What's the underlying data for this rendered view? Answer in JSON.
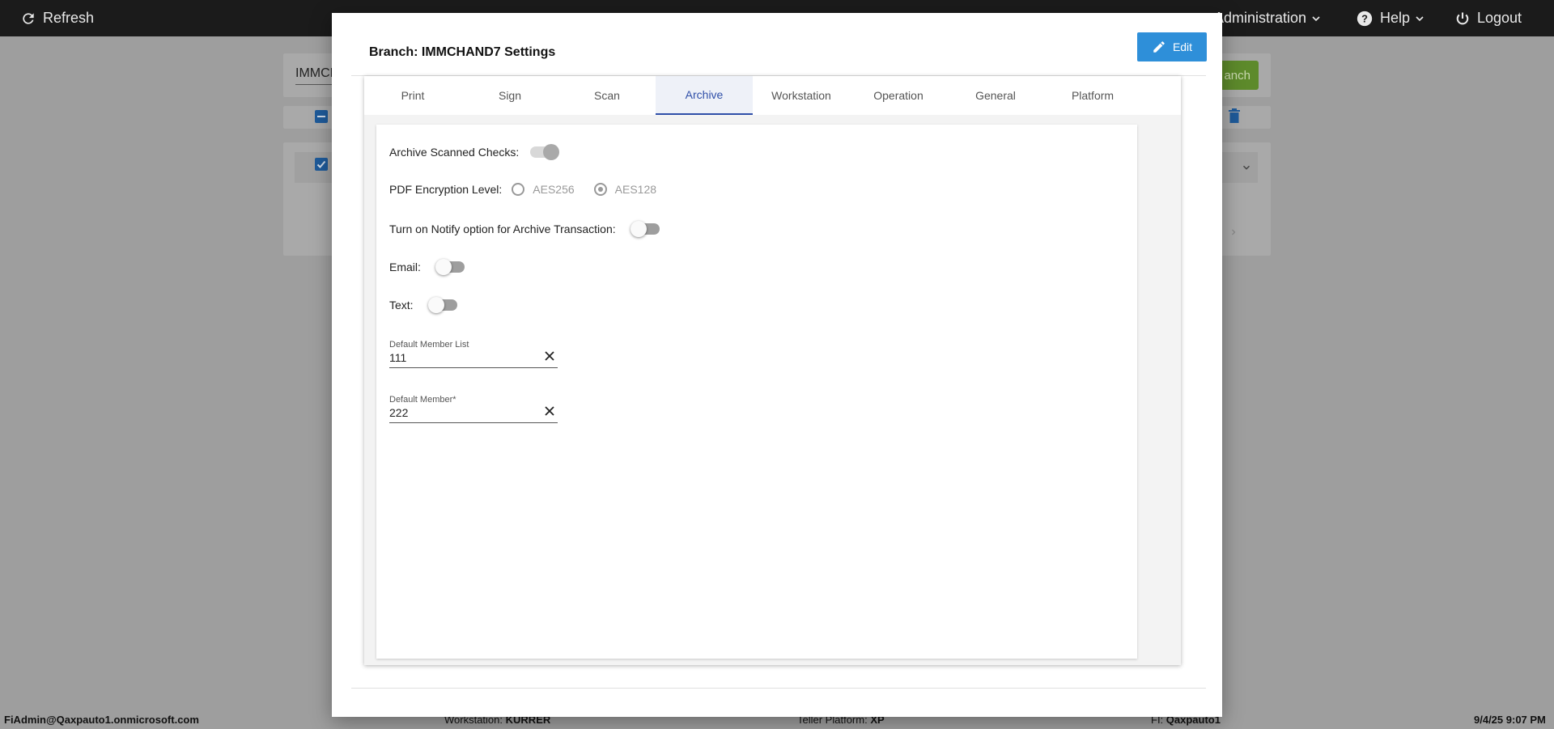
{
  "topbar": {
    "refresh_label": "Refresh",
    "administration_label": "Administration",
    "help_label": "Help",
    "logout_label": "Logout"
  },
  "background": {
    "search_text": "IMMCH",
    "green_button_partial": "anch"
  },
  "footer": {
    "user": "FiAdmin@Qaxpauto1.onmicrosoft.com",
    "workstation_label": "Workstation:",
    "workstation_value": "KURRER",
    "platform_label": "Teller Platform:",
    "platform_value": "XP",
    "fi_label": "FI:",
    "fi_value": "Qaxpauto1",
    "datetime": "9/4/25 9:07 PM"
  },
  "modal": {
    "title": "Branch: IMMCHAND7 Settings",
    "edit_label": "Edit",
    "tabs": [
      {
        "label": "Print"
      },
      {
        "label": "Sign"
      },
      {
        "label": "Scan"
      },
      {
        "label": "Archive"
      },
      {
        "label": "Workstation"
      },
      {
        "label": "Operation"
      },
      {
        "label": "General"
      },
      {
        "label": "Platform"
      }
    ],
    "active_tab": "Archive",
    "archive": {
      "archive_scanned_checks_label": "Archive Scanned Checks:",
      "archive_scanned_checks_on": true,
      "pdf_encryption_label": "PDF Encryption Level:",
      "pdf_options": [
        "AES256",
        "AES128"
      ],
      "pdf_selected": "AES128",
      "notify_label": "Turn on Notify option for Archive Transaction:",
      "notify_on": false,
      "email_label": "Email:",
      "email_on": false,
      "text_label": "Text:",
      "text_on": false,
      "default_member_list_label": "Default Member List",
      "default_member_list_value": "111",
      "default_member_label": "Default Member*",
      "default_member_value": "222"
    }
  },
  "colors": {
    "accent_blue": "#2e8fd9",
    "tab_active": "#2f4fa8",
    "topbar": "#1b1b1b",
    "overlay": "#9e9e9e"
  }
}
